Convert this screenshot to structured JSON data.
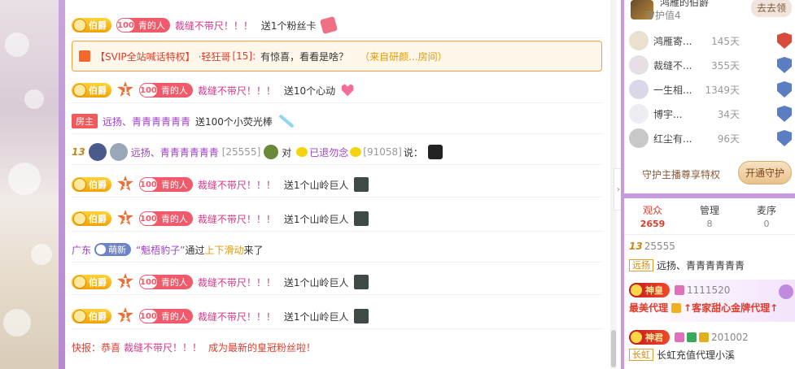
{
  "chat": {
    "row1": {
      "badge": "伯爵",
      "fan_lv": "100",
      "fan_name": "青的人",
      "user": "裁缝不带尺！！！",
      "msg": "送1个粉丝卡"
    },
    "svip": {
      "tag": "【SVIP全站喊话特权】",
      "nick": "·轻狂哥",
      "level": "[15]:",
      "text": "有惊喜，看看是啥？",
      "from": "（来自研颜...房间）"
    },
    "row3": {
      "badge": "伯爵",
      "rank": "1",
      "fan_lv": "100",
      "fan_name": "青的人",
      "user": "裁缝不带尺！！！",
      "msg": "送10个心动"
    },
    "row4": {
      "host": "房主",
      "user": "远扬、青青青青青青",
      "msg": "送100个小荧光棒"
    },
    "row5": {
      "level": "13",
      "user": "远扬、青青青青青青",
      "uid": "[25555]",
      "to": "对",
      "target": "已退勿念",
      "target_id": "[91058]",
      "say": "说："
    },
    "row6": {
      "badge": "伯爵",
      "rank": "1",
      "fan_lv": "100",
      "fan_name": "青的人",
      "user": "裁缝不带尺！！！",
      "msg": "送1个山岭巨人"
    },
    "row7": {
      "badge": "伯爵",
      "rank": "1",
      "fan_lv": "100",
      "fan_name": "青的人",
      "user": "裁缝不带尺！！！",
      "msg": "送1个山岭巨人"
    },
    "row8": {
      "region": "广东",
      "tag": "萌新",
      "user": "“魁梧豹子”",
      "via": "通过",
      "method": "上下滑动",
      "came": "来了"
    },
    "row9": {
      "badge": "伯爵",
      "rank": "1",
      "fan_lv": "100",
      "fan_name": "青的人",
      "user": "裁缝不带尺！！！",
      "msg": "送1个山岭巨人"
    },
    "row10": {
      "badge": "伯爵",
      "rank": "1",
      "fan_lv": "100",
      "fan_name": "青的人",
      "user": "裁缝不带尺！！！",
      "msg": "送1个山岭巨人"
    },
    "row11": {
      "prefix": "快报：恭喜",
      "user": "裁缝不带尺！！！",
      "suffix": "成为最新的皇冠粉丝啦！"
    }
  },
  "right": {
    "guard": {
      "title": "鸿雁的伯爵",
      "value": "守护值4",
      "go": "去去领"
    },
    "guards": [
      {
        "name": "鸿雁寄...",
        "days": "145天"
      },
      {
        "name": "裁缝不...",
        "days": "355天"
      },
      {
        "name": "一生相...",
        "days": "1349天"
      },
      {
        "name": "博宇...",
        "days": "34天"
      },
      {
        "name": "红尘有...",
        "days": "96天"
      }
    ],
    "privilege_text": "守护主播尊享特权",
    "privilege_btn": "开通守护",
    "tabs": [
      {
        "label": "观众",
        "count": "2659"
      },
      {
        "label": "管理",
        "count": "8"
      },
      {
        "label": "麦序",
        "count": "0"
      }
    ],
    "viewers": [
      {
        "level": "13",
        "id": "25555",
        "band": "远扬",
        "name": "远扬、青青青青青青"
      },
      {
        "noble": "神皇",
        "id": "1111520",
        "role": "最美代理",
        "name": "↑客家甜心金牌代理↑"
      },
      {
        "noble": "神君",
        "id": "201002",
        "band": "长虹",
        "name": "长虹充值代理小溪"
      }
    ]
  }
}
